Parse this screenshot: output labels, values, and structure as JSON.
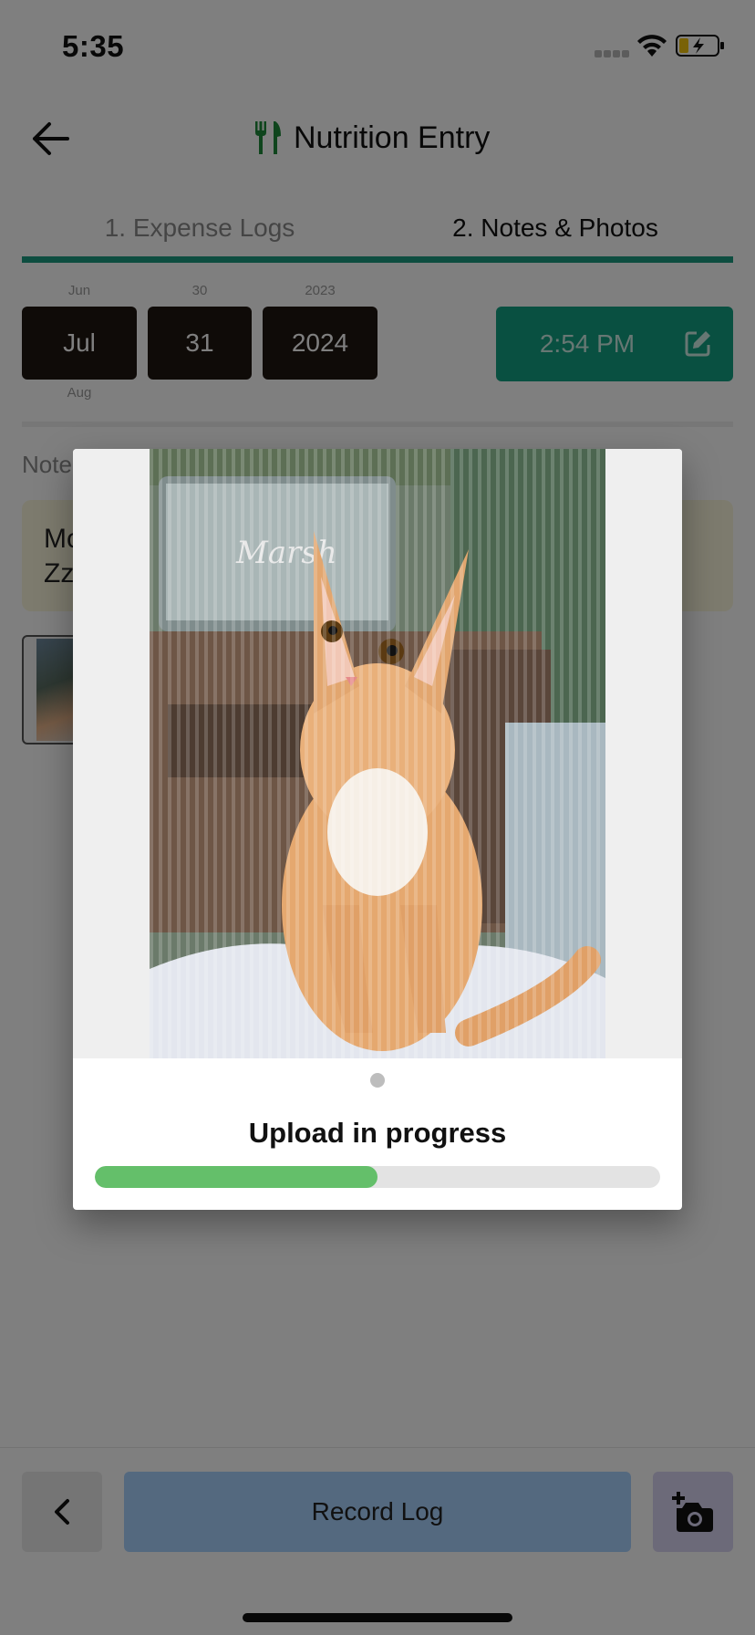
{
  "status_bar": {
    "time": "5:35"
  },
  "header": {
    "title": "Nutrition Entry",
    "icon": "utensils-icon"
  },
  "tabs": [
    {
      "label": "1. Expense Logs"
    },
    {
      "label": "2. Notes & Photos"
    }
  ],
  "date_picker": {
    "month": {
      "prev": "Jun",
      "current": "Jul",
      "next": "Aug"
    },
    "day": {
      "prev": "30",
      "current": "31",
      "next": ""
    },
    "year": {
      "prev": "2023",
      "current": "2024",
      "next": ""
    }
  },
  "time_button": {
    "label": "2:54 PM"
  },
  "notes": {
    "label": "Note",
    "line1": "Mo",
    "line2": "Zz"
  },
  "footer": {
    "record_label": "Record Log"
  },
  "upload_modal": {
    "status_text": "Upload in progress",
    "progress": 0.5
  },
  "colors": {
    "accent": "#12a182",
    "progress": "#64bf6a",
    "record_button": "#a9d2ff",
    "camera_button": "#d9d4f3",
    "picker_box": "#1f1611"
  }
}
